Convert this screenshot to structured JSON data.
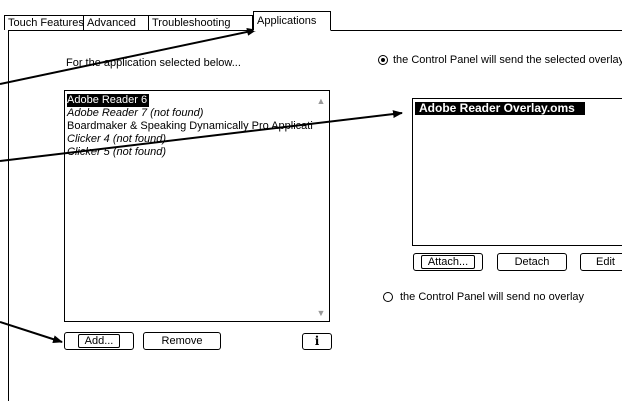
{
  "tabs": [
    {
      "label": "Touch Features"
    },
    {
      "label": "Advanced"
    },
    {
      "label": "Troubleshooting"
    },
    {
      "label": "Applications"
    }
  ],
  "left_instruction": "For the application selected below...",
  "apps": [
    {
      "label": "Adobe Reader 6",
      "selected": true,
      "italic": false
    },
    {
      "label": "Adobe Reader 7 (not found)",
      "selected": false,
      "italic": true
    },
    {
      "label": "Boardmaker & Speaking Dynamically Pro Applicati",
      "selected": false,
      "italic": false
    },
    {
      "label": "Clicker 4 (not found)",
      "selected": false,
      "italic": true
    },
    {
      "label": "Clicker 5 (not found)",
      "selected": false,
      "italic": true
    }
  ],
  "buttons": {
    "add": "Add...",
    "remove": "Remove",
    "info": "i",
    "attach": "Attach...",
    "detach": "Detach",
    "edit": "Edit"
  },
  "radio_send_selected": {
    "label": "the Control Panel will send the selected overlay",
    "checked": true
  },
  "radio_send_none": {
    "label": "the Control Panel will send no overlay",
    "checked": false
  },
  "overlays": [
    {
      "label": "Adobe Reader Overlay.oms",
      "selected": true
    }
  ]
}
